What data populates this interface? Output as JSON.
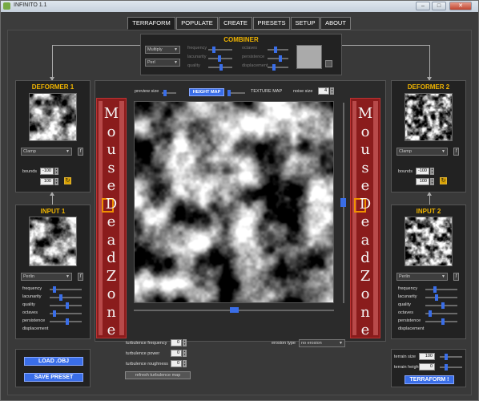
{
  "window": {
    "title": "INFINITO 1.1",
    "minimize": "–",
    "maximize": "□",
    "close": "✕"
  },
  "tabs": [
    {
      "label": "TERRAFORM",
      "active": true
    },
    {
      "label": "POPULATE"
    },
    {
      "label": "CREATE"
    },
    {
      "label": "PRESETS"
    },
    {
      "label": "SETUP"
    },
    {
      "label": "ABOUT"
    }
  ],
  "combiner": {
    "title": "COMBINER",
    "mode": "Multiply",
    "noise": "Perl",
    "labels": [
      "frequency",
      "lacunarity",
      "quality",
      "octaves",
      "persistence",
      "displacement"
    ]
  },
  "deformer1": {
    "title": "DEFORMER 1",
    "mode": "Clamp",
    "bounds_label": "bounds",
    "bound_min": "-100",
    "bound_max": "100"
  },
  "deformer2": {
    "title": "DEFORMER 2",
    "mode": "Clamp",
    "bounds_label": "bounds",
    "bound_min": "-100",
    "bound_max": "100"
  },
  "input1": {
    "title": "INPUT 1",
    "noise": "Perlin",
    "labels": [
      "frequency",
      "lacunarity",
      "quality",
      "octaves",
      "persistence",
      "displacement"
    ]
  },
  "input2": {
    "title": "INPUT 2",
    "noise": "Perlin",
    "labels": [
      "frequency",
      "lacunarity",
      "quality",
      "octaves",
      "persistence",
      "displacement"
    ]
  },
  "preview": {
    "preview_size_label": "preview size",
    "height_map_label": "HEIGHT MAP",
    "texture_map_label": "TEXTURE MAP",
    "noise_size_label": "noise size",
    "noise_size_value": "4"
  },
  "deadzone_text": [
    "M",
    "o",
    "u",
    "s",
    "e",
    "D",
    "e",
    "a",
    "d",
    "Z",
    "o",
    "n",
    "e"
  ],
  "turbulence": {
    "frequency_label": "turbulence frequency",
    "frequency_value": "0",
    "power_label": "turbulence power",
    "power_value": "0",
    "roughness_label": "turbulence roughness",
    "roughness_value": "0",
    "refresh_label": "refresh turbulence map"
  },
  "erosion": {
    "label": "erosion type",
    "value": "no erosion"
  },
  "buttons": {
    "load_obj": "LOAD .OBJ",
    "save_preset": "SAVE PRESET",
    "terraform": "TERRAFORM !"
  },
  "terrain": {
    "size_label": "terrain size",
    "size_value": "100",
    "height_label": "terrain height",
    "height_value": "0"
  },
  "colors": {
    "accent": "#3a6ee8",
    "title": "#f0b400",
    "deadzone": "#8a1c1c"
  }
}
